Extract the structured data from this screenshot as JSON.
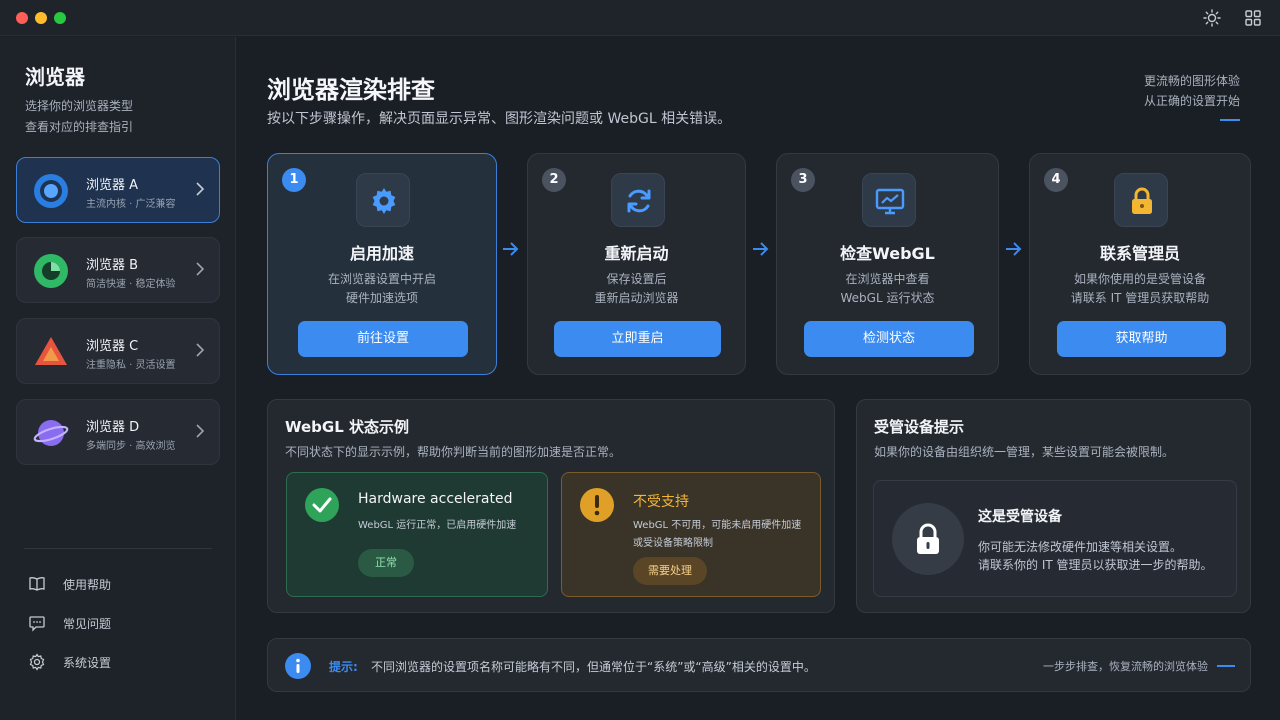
{
  "sidebar": {
    "title": "浏览器",
    "subtitle_line1": "选择你的浏览器类型",
    "subtitle_line2": "查看对应的排查指引",
    "browsers": [
      {
        "name": "浏览器 A",
        "desc": "主流内核 · 广泛兼容",
        "icon": "browser-a-logo"
      },
      {
        "name": "浏览器 B",
        "desc": "简洁快速 · 稳定体验",
        "icon": "browser-b-logo"
      },
      {
        "name": "浏览器 C",
        "desc": "注重隐私 · 灵活设置",
        "icon": "browser-c-logo"
      },
      {
        "name": "浏览器 D",
        "desc": "多端同步 · 高效浏览",
        "icon": "browser-d-logo"
      }
    ],
    "links": [
      {
        "label": "使用帮助",
        "icon": "book-icon"
      },
      {
        "label": "常见问题",
        "icon": "chat-icon"
      },
      {
        "label": "系统设置",
        "icon": "gear-icon"
      }
    ]
  },
  "header": {
    "title": "浏览器渲染排查",
    "subtitle": "按以下步骤操作，解决页面显示异常、图形渲染问题或 WebGL 相关错误。",
    "tagline_line1": "更流畅的图形体验",
    "tagline_line2": "从正确的设置开始"
  },
  "steps": [
    {
      "num": "1",
      "title": "启用加速",
      "desc1": "在浏览器设置中开启",
      "desc2": "硬件加速选项",
      "button": "前往设置",
      "icon": "gear-icon"
    },
    {
      "num": "2",
      "title": "重新启动",
      "desc1": "保存设置后",
      "desc2": "重新启动浏览器",
      "button": "立即重启",
      "icon": "refresh-icon"
    },
    {
      "num": "3",
      "title": "检查WebGL",
      "desc1": "在浏览器中查看",
      "desc2": "WebGL 运行状态",
      "button": "检测状态",
      "icon": "monitor-chart-icon"
    },
    {
      "num": "4",
      "title": "联系管理员",
      "desc1": "如果你使用的是受管设备",
      "desc2": "请联系 IT 管理员获取帮助",
      "button": "获取帮助",
      "icon": "lock-icon"
    }
  ],
  "webgl_panel": {
    "title": "WebGL 状态示例",
    "subtitle": "不同状态下的显示示例，帮助你判断当前的图形加速是否正常。",
    "ok": {
      "title": "Hardware accelerated",
      "desc": "WebGL 运行正常，已启用硬件加速",
      "badge": "正常"
    },
    "warn": {
      "title": "不受支持",
      "desc1": "WebGL 不可用，可能未启用硬件加速",
      "desc2": "或受设备策略限制",
      "badge": "需要处理"
    }
  },
  "managed_panel": {
    "title": "受管设备提示",
    "subtitle": "如果你的设备由组织统一管理，某些设置可能会被限制。",
    "card_title": "这是受管设备",
    "card_desc1": "你可能无法修改硬件加速等相关设置。",
    "card_desc2": "请联系你的 IT 管理员以获取进一步的帮助。"
  },
  "tip": {
    "label": "提示:",
    "text": "不同浏览器的设置项名称可能略有不同，但通常位于“系统”或“高级”相关的设置中。",
    "right": "一步步排查，恢复流畅的浏览体验"
  },
  "colors": {
    "accent": "#3b8bf0",
    "success": "#2fa35a",
    "warning": "#e0a028",
    "background": "#1a1e25"
  }
}
